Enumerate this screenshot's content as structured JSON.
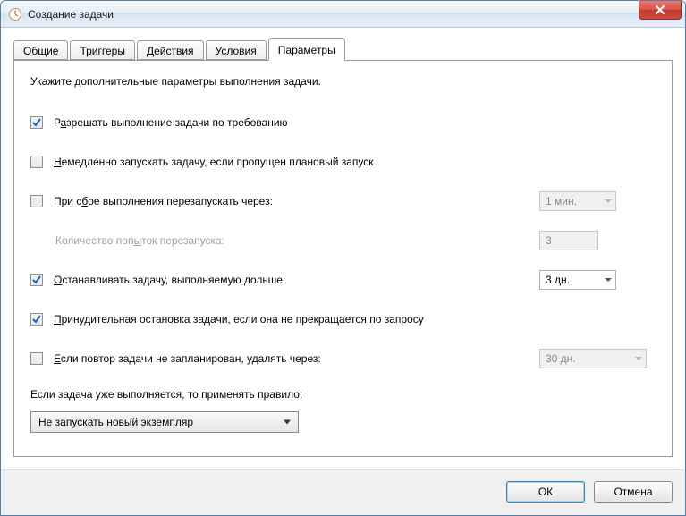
{
  "window": {
    "title": "Создание задачи"
  },
  "tabs": {
    "t0": "Общие",
    "t1": "Триггеры",
    "t2": "Действия",
    "t3": "Условия",
    "t4": "Параметры"
  },
  "panel": {
    "instruction": "Укажите дополнительные параметры выполнения задачи.",
    "allow_on_demand": {
      "checked": true,
      "pre": "Р",
      "u": "а",
      "post": "зрешать выполнение задачи по требованию"
    },
    "run_asap": {
      "checked": false,
      "pre": "",
      "u": "Н",
      "post": "емедленно запускать задачу, если пропущен плановый запуск"
    },
    "restart_on_fail": {
      "checked": false,
      "pre": "При с",
      "u": "б",
      "post": "ое выполнения перезапускать через:",
      "value": "1 мин."
    },
    "restart_count": {
      "label_pre": "Количество поп",
      "label_u": "ы",
      "label_post": "ток перезапуска:",
      "value": "3"
    },
    "stop_longer": {
      "checked": true,
      "pre": "",
      "u": "О",
      "post": "станавливать задачу, выполняемую дольше:",
      "value": "3 дн."
    },
    "force_stop": {
      "checked": true,
      "pre": "",
      "u": "П",
      "post": "ринудительная остановка задачи, если она не прекращается по запросу"
    },
    "delete_after": {
      "checked": false,
      "pre": "",
      "u": "Е",
      "post": "сли повтор задачи не запланирован, удалять через:",
      "value": "30 дн."
    },
    "rule_text": "Если задача уже выполняется, то применять правило:",
    "rule_value": "Не запускать новый экземпляр"
  },
  "buttons": {
    "ok": "ОК",
    "cancel": "Отмена"
  }
}
